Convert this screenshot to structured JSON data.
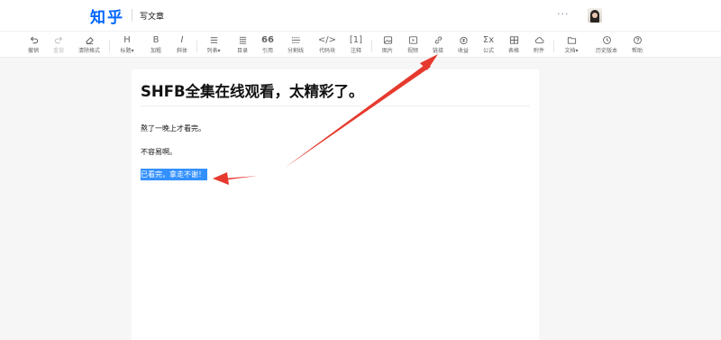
{
  "header": {
    "logo": "知乎",
    "page_name": "写文章",
    "more": "···"
  },
  "toolbar": {
    "items": [
      {
        "id": "undo",
        "icon": "undo-icon",
        "label": "撤销"
      },
      {
        "id": "redo",
        "icon": "redo-icon",
        "label": "重做"
      },
      {
        "id": "clear-format",
        "icon": "eraser-icon",
        "label": "清除格式"
      },
      {
        "id": "heading",
        "icon": "H",
        "label": "标题▾"
      },
      {
        "id": "bold",
        "icon": "B",
        "label": "加粗"
      },
      {
        "id": "italic",
        "icon": "I",
        "label": "斜体"
      },
      {
        "id": "list",
        "icon": "list-icon",
        "label": "列表▾"
      },
      {
        "id": "toc",
        "icon": "toc-icon",
        "label": "目录"
      },
      {
        "id": "quote",
        "icon": "66",
        "label": "引用"
      },
      {
        "id": "divider",
        "icon": "divider-icon",
        "label": "分割线"
      },
      {
        "id": "code",
        "icon": "</>",
        "label": "代码块"
      },
      {
        "id": "footnote",
        "icon": "[1]",
        "label": "注释"
      },
      {
        "id": "image",
        "icon": "image-icon",
        "label": "图片"
      },
      {
        "id": "video",
        "icon": "video-icon",
        "label": "视频"
      },
      {
        "id": "link",
        "icon": "link-icon",
        "label": "链接"
      },
      {
        "id": "revenue",
        "icon": "coin-icon",
        "label": "收益"
      },
      {
        "id": "formula",
        "icon": "Σx",
        "label": "公式"
      },
      {
        "id": "table",
        "icon": "table-icon",
        "label": "表格"
      },
      {
        "id": "attachment",
        "icon": "cloud-icon",
        "label": "附件"
      },
      {
        "id": "doc",
        "icon": "folder-icon",
        "label": "文档▾"
      },
      {
        "id": "history",
        "icon": "clock-icon",
        "label": "历史版本"
      },
      {
        "id": "help",
        "icon": "help-icon",
        "label": "帮助"
      }
    ]
  },
  "article": {
    "title": "SHFB全集在线观看，太精彩了。",
    "paragraphs": [
      "熬了一晚上才看完。",
      "不容易啊。",
      "已看完，拿走不谢！"
    ]
  },
  "colors": {
    "brand": "#0066ff",
    "selection": "#3390ff",
    "annotation": "#e63a2e"
  }
}
